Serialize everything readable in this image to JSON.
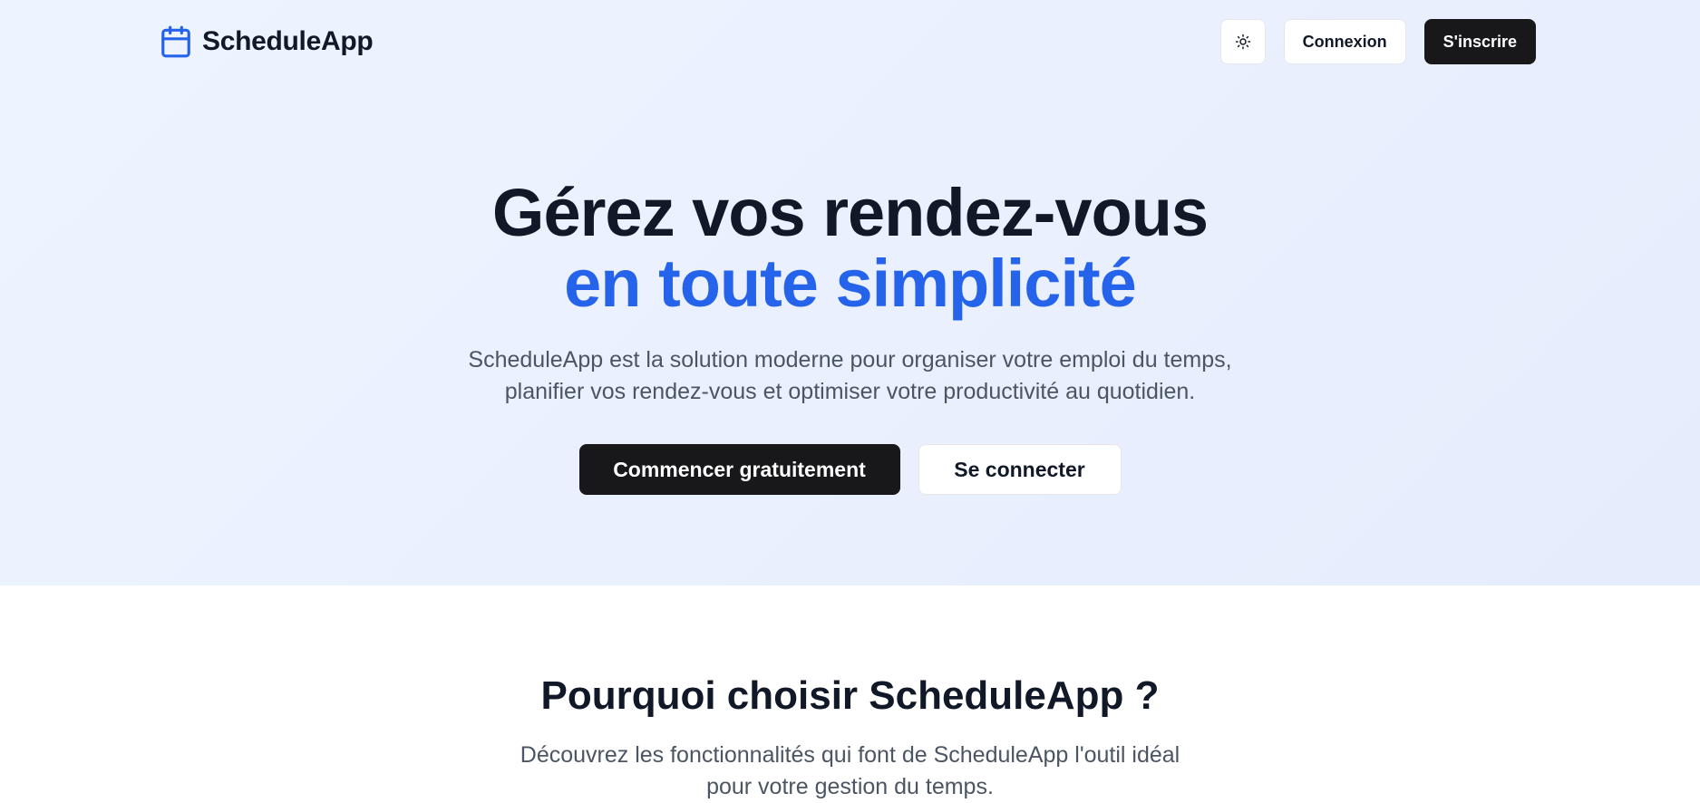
{
  "header": {
    "brand_name": "ScheduleApp",
    "brand_icon": "calendar-icon",
    "theme_toggle_icon": "sun-icon",
    "login_label": "Connexion",
    "signup_label": "S'inscrire"
  },
  "hero": {
    "title_line1": "Gérez vos rendez-vous",
    "title_line2": "en toute simplicité",
    "subtitle_line1": "ScheduleApp est la solution moderne pour organiser votre emploi du temps,",
    "subtitle_line2": "planifier vos rendez-vous et optimiser votre productivité au quotidien.",
    "primary_cta": "Commencer gratuitement",
    "secondary_cta": "Se connecter"
  },
  "features": {
    "title": "Pourquoi choisir ScheduleApp ?",
    "subtitle_line1": "Découvrez les fonctionnalités qui font de ScheduleApp l'outil idéal",
    "subtitle_line2": "pour votre gestion du temps."
  },
  "colors": {
    "accent": "#2563eb",
    "dark_button": "#18181b",
    "heading": "#111827",
    "body_text": "#4b5563",
    "hero_bg_start": "#eef4ff",
    "hero_bg_end": "#e6ecfc"
  }
}
